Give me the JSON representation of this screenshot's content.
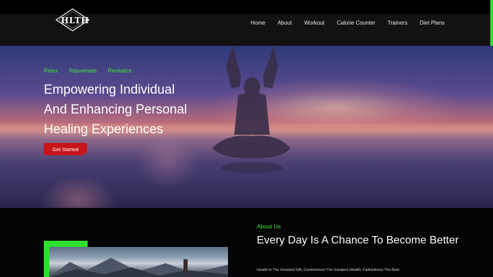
{
  "brand": {
    "logo_text": "HLTH"
  },
  "nav": {
    "items": [
      {
        "label": "Home"
      },
      {
        "label": "About"
      },
      {
        "label": "Workout"
      },
      {
        "label": "Calorie Counter"
      },
      {
        "label": "Trainers"
      },
      {
        "label": "Diet Plans"
      }
    ]
  },
  "hero": {
    "tagline": [
      "Relax.",
      "Rejuvenate.",
      "Revitalize."
    ],
    "title_lines": [
      "Empowering Individual",
      "And Enhancing Personal",
      "Healing Experiences"
    ],
    "cta_label": "Get Started"
  },
  "about": {
    "label": "About Us",
    "title": "Every Day Is A Chance To Become Better",
    "text": "Health Is The Greatest Gift, Contentment The Greatest Wealth, Faithfulness The Best"
  },
  "colors": {
    "accent_green": "#2ee02e",
    "cta_red": "#c8141b",
    "background": "#050505"
  }
}
